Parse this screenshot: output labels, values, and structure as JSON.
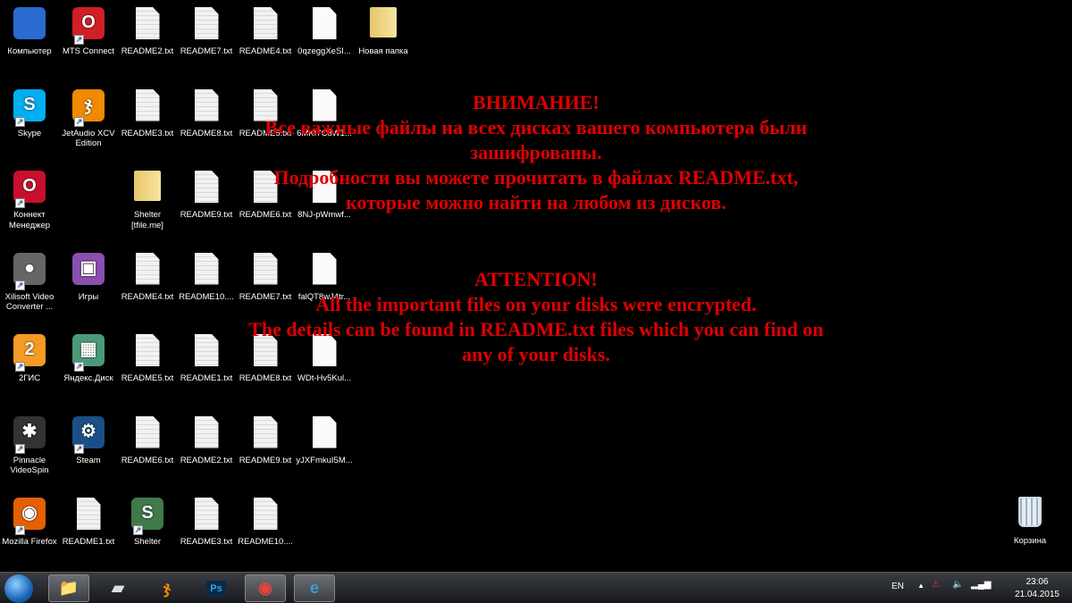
{
  "desktop": {
    "columns": [
      [
        {
          "label": "Компьютер",
          "icon": "computer-icon",
          "kind": "app",
          "color": "#2a6bd1"
        },
        {
          "label": "Skype",
          "icon": "skype-icon",
          "kind": "app",
          "color": "#00aff0",
          "glyph": "S",
          "shortcut": true
        },
        {
          "label": "Коннект Менеджер",
          "icon": "connect-manager-icon",
          "kind": "app",
          "color": "#c8102e",
          "glyph": "O",
          "shortcut": true
        },
        {
          "label": "Xilisoft Video Converter ...",
          "icon": "film-reel-icon",
          "kind": "app",
          "color": "#666",
          "glyph": "●",
          "shortcut": true
        },
        {
          "label": "2ГИС",
          "icon": "2gis-icon",
          "kind": "app",
          "color": "#f59a23",
          "glyph": "2",
          "shortcut": true
        },
        {
          "label": "Pinnacle VideoSpin",
          "icon": "clapperboard-icon",
          "kind": "app",
          "color": "#333",
          "glyph": "✱",
          "shortcut": true
        },
        {
          "label": "Mozilla Firefox",
          "icon": "firefox-icon",
          "kind": "app",
          "color": "#e66000",
          "glyph": "◉",
          "shortcut": true
        }
      ],
      [
        {
          "label": "MTS Connect",
          "icon": "mts-connect-icon",
          "kind": "app",
          "color": "#d01f26",
          "glyph": "O",
          "shortcut": true
        },
        {
          "label": "JetAudio XCV Edition",
          "icon": "jetaudio-icon",
          "kind": "app",
          "color": "#f08a00",
          "glyph": "ჯ",
          "shortcut": true
        },
        {
          "kind": "empty"
        },
        {
          "label": "Игры",
          "icon": "games-folder-icon",
          "kind": "app",
          "color": "#8a4fb0",
          "glyph": "▣"
        },
        {
          "label": "Яндекс.Диск",
          "icon": "yandex-disk-icon",
          "kind": "app",
          "color": "#4a9a7a",
          "glyph": "▦",
          "shortcut": true
        },
        {
          "label": "Steam",
          "icon": "steam-icon",
          "kind": "app",
          "color": "#1b4f87",
          "glyph": "⚙",
          "shortcut": true
        },
        {
          "label": "README1.txt",
          "icon": "text-file-icon",
          "kind": "txt"
        }
      ],
      [
        {
          "label": "README2.txt",
          "icon": "text-file-icon",
          "kind": "txt"
        },
        {
          "label": "README3.txt",
          "icon": "text-file-icon",
          "kind": "txt"
        },
        {
          "label": "Shelter [tfile.me]",
          "icon": "folder-icon",
          "kind": "folder"
        },
        {
          "label": "README4.txt",
          "icon": "text-file-icon",
          "kind": "txt"
        },
        {
          "label": "README5.txt",
          "icon": "text-file-icon",
          "kind": "txt"
        },
        {
          "label": "README6.txt",
          "icon": "text-file-icon",
          "kind": "txt"
        },
        {
          "label": "Shelter",
          "icon": "shelter-icon",
          "kind": "app",
          "color": "#3f7a4a",
          "glyph": "S",
          "shortcut": true
        }
      ],
      [
        {
          "label": "README7.txt",
          "icon": "text-file-icon",
          "kind": "txt"
        },
        {
          "label": "README8.txt",
          "icon": "text-file-icon",
          "kind": "txt"
        },
        {
          "label": "README9.txt",
          "icon": "text-file-icon",
          "kind": "txt"
        },
        {
          "label": "README10....",
          "icon": "text-file-icon",
          "kind": "txt"
        },
        {
          "label": "README1.txt",
          "icon": "text-file-icon",
          "kind": "txt"
        },
        {
          "label": "README2.txt",
          "icon": "text-file-icon",
          "kind": "txt"
        },
        {
          "label": "README3.txt",
          "icon": "text-file-icon",
          "kind": "txt"
        }
      ],
      [
        {
          "label": "README4.txt",
          "icon": "text-file-icon",
          "kind": "txt"
        },
        {
          "label": "README5.txt",
          "icon": "text-file-icon",
          "kind": "txt"
        },
        {
          "label": "README6.txt",
          "icon": "text-file-icon",
          "kind": "txt"
        },
        {
          "label": "README7.txt",
          "icon": "text-file-icon",
          "kind": "txt"
        },
        {
          "label": "README8.txt",
          "icon": "text-file-icon",
          "kind": "txt"
        },
        {
          "label": "README9.txt",
          "icon": "text-file-icon",
          "kind": "txt"
        },
        {
          "label": "README10....",
          "icon": "text-file-icon",
          "kind": "txt"
        }
      ],
      [
        {
          "label": "0qzeggXeSI...",
          "icon": "encrypted-file-icon",
          "kind": "blank"
        },
        {
          "label": "6MKI7C8W1...",
          "icon": "encrypted-file-icon",
          "kind": "blank"
        },
        {
          "label": "8NJ-pWmwf...",
          "icon": "encrypted-file-icon",
          "kind": "blank"
        },
        {
          "label": "falQT8wJ4tr...",
          "icon": "encrypted-file-icon",
          "kind": "blank"
        },
        {
          "label": "WDt-Hv5Kul...",
          "icon": "encrypted-file-icon",
          "kind": "blank"
        },
        {
          "label": "yJXFmkuI5M...",
          "icon": "encrypted-file-icon",
          "kind": "blank"
        }
      ],
      [
        {
          "label": "Новая папка",
          "icon": "folder-icon",
          "kind": "folder"
        }
      ]
    ],
    "recycle_bin": {
      "label": "Корзина"
    }
  },
  "message": {
    "ru": [
      "ВНИМАНИЕ!",
      "Все важные файлы на всех дисках вашего компьютера были",
      "зашифрованы.",
      "Подробности вы можете прочитать в файлах README.txt,",
      "которые можно найти на любом из дисков."
    ],
    "en": [
      "ATTENTION!",
      "All the important files on your disks were encrypted.",
      "The details can be found in README.txt files which you can find on",
      "any of your disks."
    ]
  },
  "taskbar": {
    "apps": [
      {
        "name": "explorer",
        "icon": "file-explorer-icon",
        "glyph": "📁",
        "color": "#f0d070",
        "active": true
      },
      {
        "name": "scanner",
        "icon": "scanner-icon",
        "glyph": "▰",
        "color": "#ddd"
      },
      {
        "name": "jetaudio",
        "icon": "jetaudio-icon",
        "glyph": "ჯ",
        "color": "#f08a00"
      },
      {
        "name": "photoshop",
        "icon": "photoshop-icon",
        "glyph": "Ps",
        "color": "#2fa3f7"
      },
      {
        "name": "chrome",
        "icon": "chrome-icon",
        "glyph": "◉",
        "color": "#e8453c",
        "active": true
      },
      {
        "name": "internet-explorer",
        "icon": "internet-explorer-icon",
        "glyph": "e",
        "color": "#3a9be0",
        "active": true
      }
    ],
    "lang": "EN",
    "time": "23:06",
    "date": "21.04.2015"
  }
}
